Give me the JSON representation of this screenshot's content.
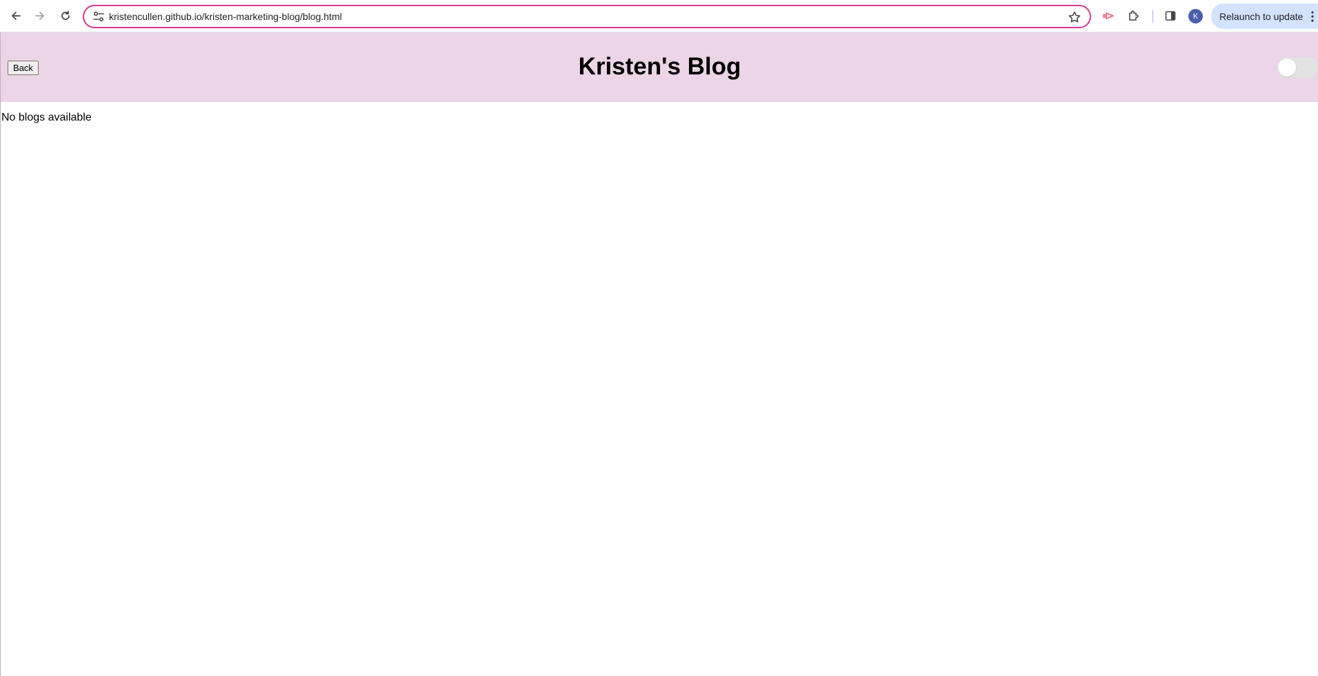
{
  "browser": {
    "url": "kristencullen.github.io/kristen-marketing-blog/blog.html",
    "profile_initial": "K",
    "relaunch_label": "Relaunch to update",
    "icons": [
      "back-arrow-icon",
      "forward-arrow-icon",
      "reload-icon",
      "site-info-icon",
      "bookmark-star-icon",
      "cast-icon",
      "extensions-puzzle-icon",
      "side-panel-icon",
      "kebab-menu-icon"
    ],
    "colors": {
      "omnibox_border": "#d9368e",
      "relaunch_bg": "#d3e3fd",
      "avatar_bg": "#4b5fae"
    }
  },
  "page": {
    "back_label": "Back",
    "title": "Kristen's Blog",
    "empty_message": "No blogs available",
    "theme_toggle_on": false,
    "colors": {
      "header_bg": "#ebd5e6",
      "toggle_track": "#e3e3e3"
    }
  }
}
